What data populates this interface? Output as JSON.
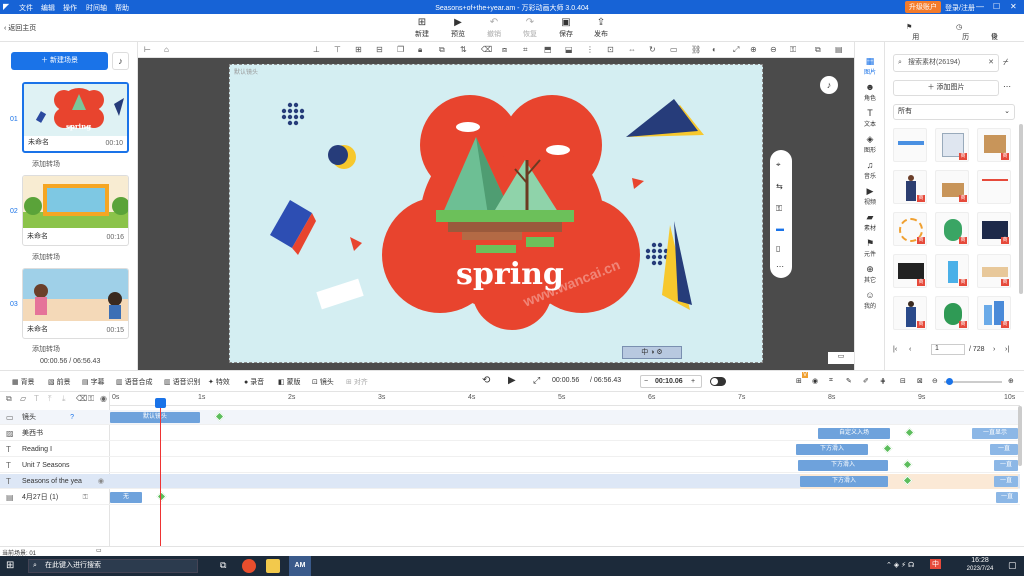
{
  "window": {
    "title": "Seasons+of+the+year.am - 万彩动画大师 3.0.404",
    "menu": [
      "文件",
      "编辑",
      "操作",
      "时间轴",
      "帮助"
    ],
    "upgrade_label": "升级账户",
    "login_label": "登录/注册"
  },
  "toolbar": {
    "back_label": "返回主页",
    "buttons": [
      {
        "label": "新建",
        "icon": "new-icon"
      },
      {
        "label": "预览",
        "icon": "play-icon"
      },
      {
        "label": "撤销",
        "icon": "undo-icon"
      },
      {
        "label": "恢复",
        "icon": "redo-icon"
      },
      {
        "label": "保存",
        "icon": "save-icon"
      },
      {
        "label": "发布",
        "icon": "publish-icon"
      }
    ],
    "feedback_label": "用户反馈",
    "history_label": "历史",
    "settings_label": "设置"
  },
  "scenes": {
    "new_label": "新建场景",
    "add_transition": "添加转场",
    "items": [
      {
        "index": "01",
        "name": "未命名",
        "duration": "00:10",
        "thumb_text": "spring"
      },
      {
        "index": "02",
        "name": "未命名",
        "duration": "00:16"
      },
      {
        "index": "03",
        "name": "未命名",
        "duration": "00:15"
      }
    ],
    "time_current": "00:00.56",
    "time_total": "06:56.43"
  },
  "stage": {
    "camera_label": "默认镜头",
    "spring_text": "spring",
    "watermark": "www.wancai.cn"
  },
  "side_tabs": [
    "图片",
    "角色",
    "文本",
    "图形",
    "音乐",
    "视频",
    "素材",
    "元件",
    "其它",
    "我的"
  ],
  "assets": {
    "search_placeholder": "搜索素材(26194)",
    "add_image_label": "添加图片",
    "filter_label": "所有",
    "page_current": "1",
    "page_total": "/ 728",
    "badge": "商"
  },
  "playbar": {
    "tools": [
      "背景",
      "前景",
      "字幕",
      "语音合成",
      "语音识别",
      "特效",
      "录音",
      "蒙版",
      "镜头",
      "对齐"
    ],
    "time_current": "00:00.56",
    "time_total": "/ 06:56.43",
    "zoom_value": "00:10.06"
  },
  "timeline": {
    "tracks": [
      {
        "name": "镜头",
        "icon": "camera-icon"
      },
      {
        "name": "美西书",
        "icon": "image-icon"
      },
      {
        "name": "Reading Ⅰ",
        "icon": "text-icon"
      },
      {
        "name": "Unit 7  Seasons",
        "icon": "text-icon"
      },
      {
        "name": "Seasons of the yea",
        "icon": "text-icon"
      },
      {
        "name": "4月27日 (1)",
        "icon": "film-icon"
      }
    ],
    "ruler": [
      "0s",
      "1s",
      "2s",
      "3s",
      "4s",
      "5s",
      "6s",
      "7s",
      "8s",
      "9s",
      "10s"
    ],
    "clips": {
      "camera": "默认镜头",
      "custom_enter": "自定义入场",
      "always_show": "一直显示",
      "slide_in": "下方滑入",
      "always": "一直",
      "none": "无"
    }
  },
  "status": {
    "current_scene": "当前场景: 01"
  },
  "taskbar": {
    "search_placeholder": "在此键入进行搜索",
    "time": "16:28",
    "date": "2023/7/24",
    "ime": "中"
  }
}
